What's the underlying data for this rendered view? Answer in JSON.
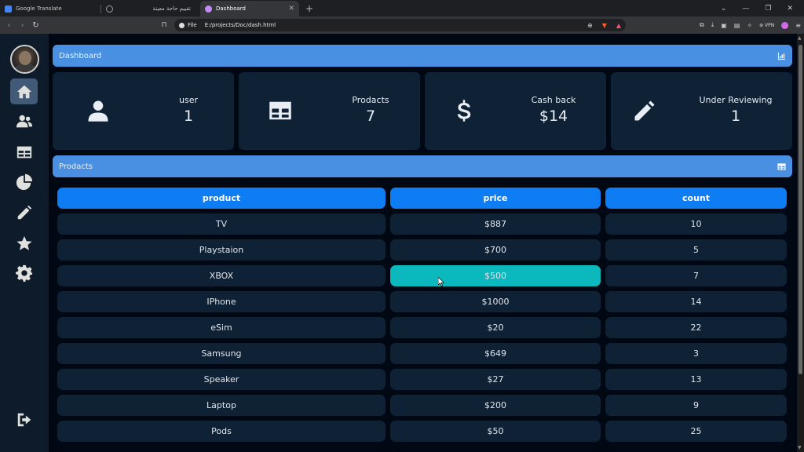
{
  "browser": {
    "tabs": [
      {
        "title": "Google Translate",
        "fav_color": "#4285f4",
        "active": false
      },
      {
        "title": "تقييم حاجة معينة",
        "fav_color": "#9aa0a6",
        "active": false
      },
      {
        "title": "Dashboard",
        "fav_color": "#c58af9",
        "active": true
      }
    ],
    "new_tab": "+",
    "window_controls": [
      "⌄",
      "—",
      "❐",
      "✕"
    ],
    "omnibox": {
      "scheme": "File",
      "url": "E:/projects/Doc/dash.html"
    },
    "vpn_label": "VPN"
  },
  "sidebar": {
    "items": [
      {
        "name": "home",
        "icon": "home-icon"
      },
      {
        "name": "users",
        "icon": "users-icon"
      },
      {
        "name": "table",
        "icon": "table-icon"
      },
      {
        "name": "chart",
        "icon": "pie-chart-icon"
      },
      {
        "name": "edit",
        "icon": "pencil-icon"
      },
      {
        "name": "favorites",
        "icon": "star-icon"
      },
      {
        "name": "settings",
        "icon": "gear-icon"
      }
    ],
    "logout_icon": "logout-icon"
  },
  "dashboard": {
    "title": "Dashboard",
    "icon": "bar-chart-icon",
    "cards": [
      {
        "label": "user",
        "value": "1",
        "icon": "user-icon"
      },
      {
        "label": "Prodacts",
        "value": "7",
        "icon": "table-icon"
      },
      {
        "label": "Cash back",
        "value": "$14",
        "icon": "dollar-icon"
      },
      {
        "label": "Under Reviewing",
        "value": "1",
        "icon": "pencil-icon"
      }
    ]
  },
  "products": {
    "title": "Prodacts",
    "icon": "table-icon",
    "columns": [
      "product",
      "price",
      "count"
    ],
    "rows": [
      [
        "TV",
        "$887",
        "10"
      ],
      [
        "Playstaion",
        "$700",
        "5"
      ],
      [
        "XBOX",
        "$500",
        "7"
      ],
      [
        "IPhone",
        "$1000",
        "14"
      ],
      [
        "eSim",
        "$20",
        "22"
      ],
      [
        "Samsung",
        "$649",
        "3"
      ],
      [
        "Speaker",
        "$27",
        "13"
      ],
      [
        "Laptop",
        "$200",
        "9"
      ],
      [
        "Pods",
        "$50",
        "25"
      ]
    ],
    "hovered_cell": {
      "row": 2,
      "col": 1
    }
  },
  "colors": {
    "accent": "#4a90e2",
    "header_cell": "#0e7cf2",
    "highlight_cell": "#0ab8be",
    "card_bg": "#0f2135",
    "sidebar_bg": "#0d1b2a"
  }
}
